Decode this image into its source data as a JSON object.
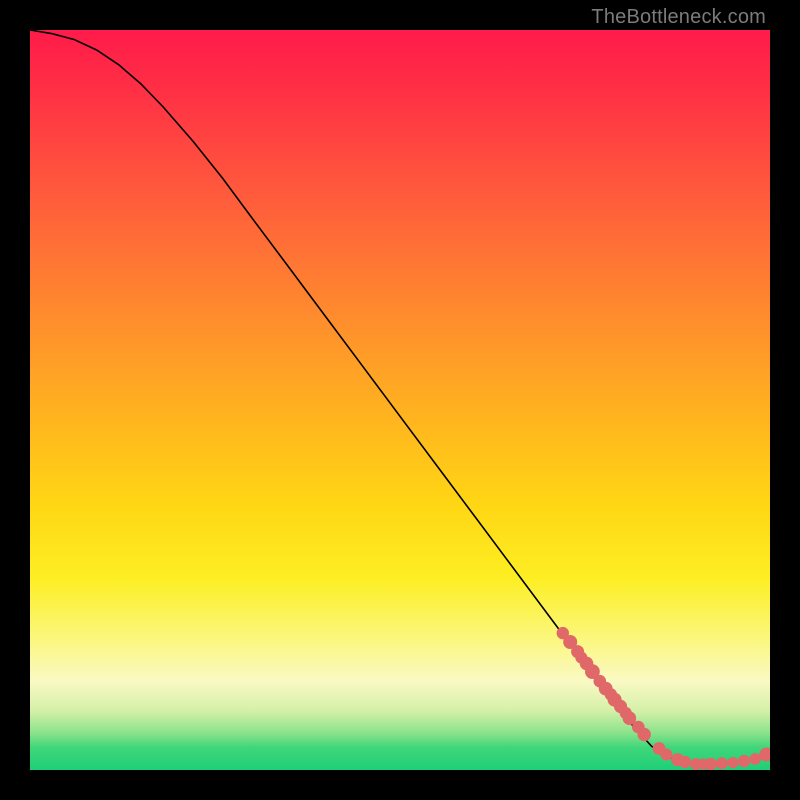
{
  "watermark": "TheBottleneck.com",
  "chart_data": {
    "type": "line",
    "title": "",
    "xlabel": "",
    "ylabel": "",
    "xlim": [
      0,
      100
    ],
    "ylim": [
      0,
      100
    ],
    "series": [
      {
        "name": "curve",
        "x": [
          0,
          3,
          6,
          9,
          12,
          15,
          18,
          22,
          26,
          30,
          35,
          40,
          45,
          50,
          55,
          60,
          65,
          70,
          75,
          80,
          84,
          87,
          90,
          93,
          96,
          98,
          100
        ],
        "y": [
          100,
          99.5,
          98.7,
          97.3,
          95.3,
          92.7,
          89.6,
          85,
          80,
          74.6,
          67.9,
          61.2,
          54.5,
          47.8,
          41.1,
          34.4,
          27.7,
          21,
          14.3,
          7.6,
          3.2,
          1.4,
          0.8,
          0.9,
          1.2,
          1.6,
          2.3
        ]
      }
    ],
    "scatter": {
      "name": "points",
      "x": [
        72,
        73,
        74,
        74.5,
        75.2,
        76,
        77,
        77.8,
        78.5,
        79,
        79.8,
        80.5,
        81,
        82.2,
        83,
        85,
        86,
        87.5,
        88.5,
        90,
        91,
        92,
        93.5,
        95,
        96.5,
        98,
        99.5
      ],
      "y": [
        18.5,
        17.3,
        16,
        15.2,
        14.4,
        13.3,
        12,
        11,
        10.2,
        9.5,
        8.6,
        7.7,
        7,
        5.8,
        4.8,
        2.9,
        2.1,
        1.4,
        1.1,
        0.8,
        0.8,
        0.8,
        0.9,
        1,
        1.2,
        1.5,
        2.1
      ],
      "r": [
        6.2,
        7,
        6.5,
        6,
        6.8,
        7.4,
        6.3,
        6.9,
        6.2,
        7,
        6.6,
        6.1,
        6.8,
        6.3,
        6.7,
        6.4,
        6,
        6.5,
        6.2,
        6,
        5.6,
        6.4,
        6,
        5.6,
        6.2,
        5.8,
        7
      ]
    }
  }
}
